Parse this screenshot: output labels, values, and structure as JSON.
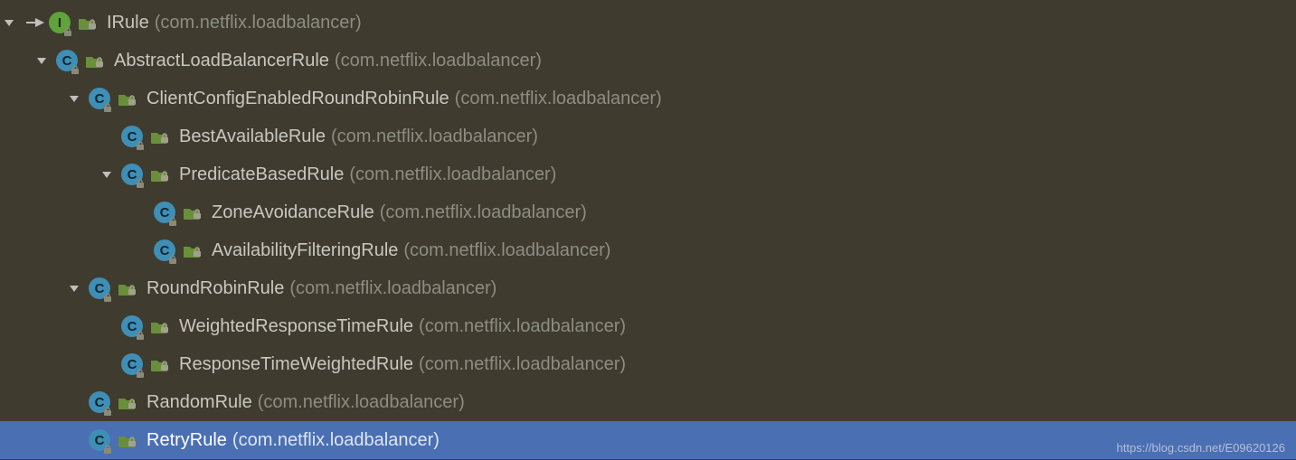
{
  "watermark": "https://blog.csdn.net/E09620126",
  "tree": [
    {
      "indent": 0,
      "expanded": true,
      "target_arrow": true,
      "kind": "interface",
      "name": "IRule",
      "pkg": "(com.netflix.loadbalancer)",
      "selected": false
    },
    {
      "indent": 1,
      "expanded": true,
      "target_arrow": false,
      "kind": "class",
      "name": "AbstractLoadBalancerRule",
      "pkg": "(com.netflix.loadbalancer)",
      "selected": false
    },
    {
      "indent": 2,
      "expanded": true,
      "target_arrow": false,
      "kind": "class",
      "name": "ClientConfigEnabledRoundRobinRule",
      "pkg": "(com.netflix.loadbalancer)",
      "selected": false
    },
    {
      "indent": 3,
      "expanded": null,
      "target_arrow": false,
      "kind": "class",
      "name": "BestAvailableRule",
      "pkg": "(com.netflix.loadbalancer)",
      "selected": false
    },
    {
      "indent": 3,
      "expanded": true,
      "target_arrow": false,
      "kind": "class",
      "name": "PredicateBasedRule",
      "pkg": "(com.netflix.loadbalancer)",
      "selected": false
    },
    {
      "indent": 4,
      "expanded": null,
      "target_arrow": false,
      "kind": "class",
      "name": "ZoneAvoidanceRule",
      "pkg": "(com.netflix.loadbalancer)",
      "selected": false
    },
    {
      "indent": 4,
      "expanded": null,
      "target_arrow": false,
      "kind": "class",
      "name": "AvailabilityFilteringRule",
      "pkg": "(com.netflix.loadbalancer)",
      "selected": false
    },
    {
      "indent": 2,
      "expanded": true,
      "target_arrow": false,
      "kind": "class",
      "name": "RoundRobinRule",
      "pkg": "(com.netflix.loadbalancer)",
      "selected": false
    },
    {
      "indent": 3,
      "expanded": null,
      "target_arrow": false,
      "kind": "class",
      "name": "WeightedResponseTimeRule",
      "pkg": "(com.netflix.loadbalancer)",
      "selected": false
    },
    {
      "indent": 3,
      "expanded": null,
      "target_arrow": false,
      "kind": "class",
      "name": "ResponseTimeWeightedRule",
      "pkg": "(com.netflix.loadbalancer)",
      "selected": false
    },
    {
      "indent": 2,
      "expanded": null,
      "target_arrow": false,
      "kind": "class",
      "name": "RandomRule",
      "pkg": "(com.netflix.loadbalancer)",
      "selected": false
    },
    {
      "indent": 2,
      "expanded": null,
      "target_arrow": false,
      "kind": "class",
      "name": "RetryRule",
      "pkg": "(com.netflix.loadbalancer)",
      "selected": true
    }
  ]
}
